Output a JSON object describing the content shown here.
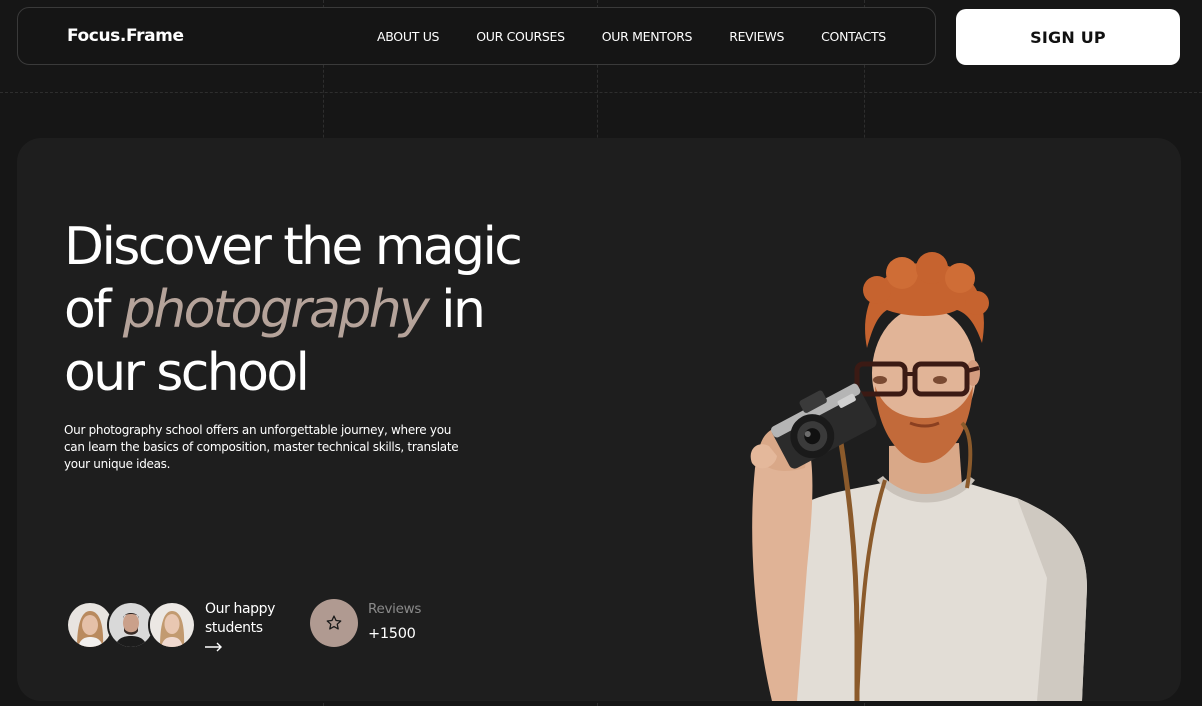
{
  "header": {
    "logo": "Focus.Frame",
    "nav": [
      "ABOUT US",
      "OUR COURSES",
      "OUR MENTORS",
      "REVIEWS",
      "CONTACTS"
    ],
    "signup_label": "SIGN UP"
  },
  "hero": {
    "headline_1": "Discover the magic",
    "headline_2_prefix": "of ",
    "headline_accent": "photography",
    "headline_2_suffix": " in",
    "headline_3": "our school",
    "description": "Our photography school offers an unforgettable journey, where you can learn the basics of composition, master technical skills, translate your unique ideas.",
    "students_label_1": "Our happy",
    "students_label_2": "students",
    "reviews_label": "Reviews",
    "reviews_count": "+1500"
  },
  "icons": {
    "arrow": "arrow-right-icon",
    "star": "star-icon"
  },
  "colors": {
    "background": "#161616",
    "card": "#1e1e1e",
    "accent": "#b5a39a",
    "star_button": "#b09a91"
  }
}
